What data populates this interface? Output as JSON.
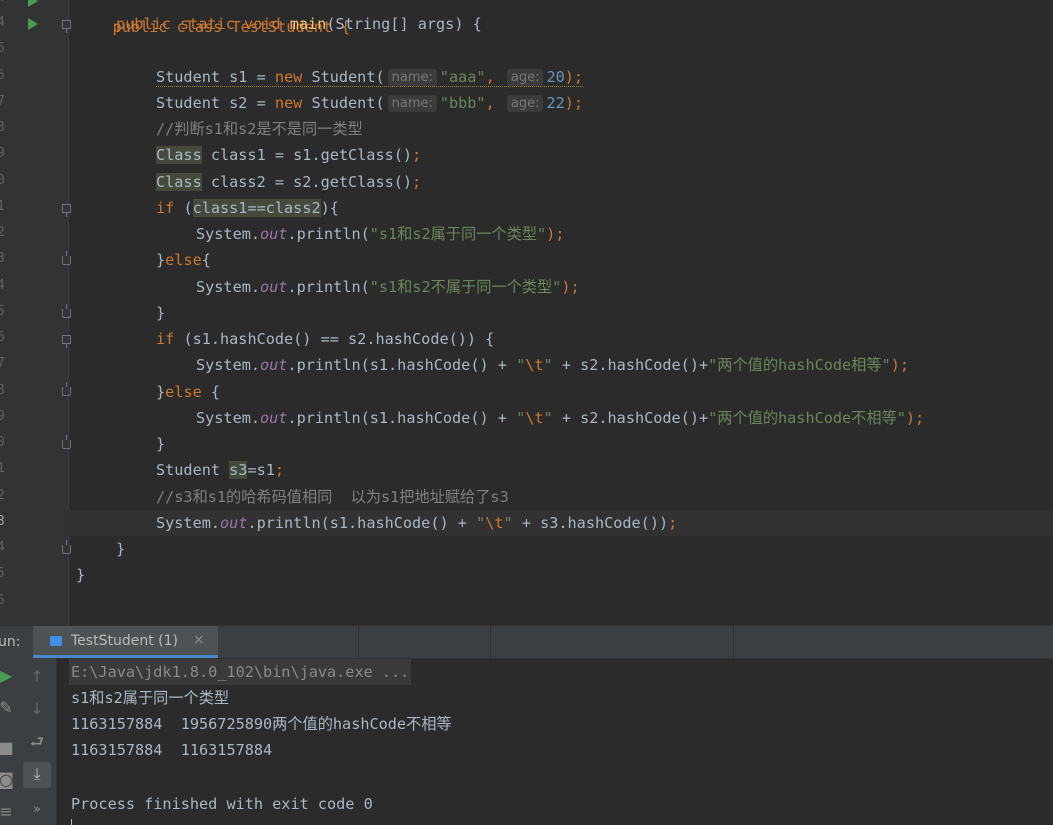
{
  "gutter": {
    "line_numbers": [
      "4",
      "4",
      "5",
      "6",
      "7",
      "8",
      "9",
      "0",
      "1",
      "2",
      "3",
      "4",
      "5",
      "6",
      "7",
      "8",
      "9",
      "0",
      "1",
      "2",
      "3",
      "4",
      "5",
      "6"
    ],
    "run_icon": "run-arrow-icon",
    "fold_icon": "fold-marker-icon"
  },
  "code": {
    "l0": "public class TestStudent {",
    "l1_kw": "public static void ",
    "l1_fn": "main",
    "l1_rest": "(String[] args) {",
    "l3_a": "Student s1 = ",
    "l3_new": "new",
    "l3_b": " Student(",
    "hint_name": "name:",
    "s1_name": "\"aaa\"",
    "comma": ", ",
    "hint_age": "age:",
    "s1_age": "20",
    "close_paren_semi": ");",
    "l4_a": "Student s2 = ",
    "s2_name": "\"bbb\"",
    "s2_age": "22",
    "comment1": "//判断s1和s2是不是同一类型",
    "class_kw": "Class",
    "l6_rest": " class1 = s1.getClass()",
    "l7_rest": " class2 = s2.getClass()",
    "semi": ";",
    "if_kw": "if",
    "else_kw": "else",
    "l8_open": " (",
    "l8_cond": "class1==class2",
    "l8_close": "){",
    "system": "System.",
    "out": "out",
    "println": ".println(",
    "str_same": "\"s1和s2属于同一个类型\"",
    "close_brace": "}",
    "open_brace": "{",
    "str_diff": "\"s1和s2不属于同一个类型\"",
    "l13_a": " (s1.hashCode() == s2.hashCode()) {",
    "hash_a": "s1.hashCode() + ",
    "q": "\"",
    "tab_esc": "\\t",
    "hash_b": " + s2.hashCode()+",
    "str_eq": "\"两个值的hashCode相等\"",
    "else_brace": " {",
    "str_neq": "\"两个值的hashCode不相等\"",
    "l18_a": "Student ",
    "l18_s3": "s3",
    "l18_b": "=s1",
    "comment2": "//s3和s1的哈希码值相同  以为s1把地址赋给了s3",
    "hash_c": " + s3.hashCode())"
  },
  "run_panel": {
    "label": "un:",
    "tab_label": "TestStudent (1)",
    "tab_close": "×",
    "toolbar_icons": [
      "run-icon",
      "wrench-icon",
      "stop-icon",
      "camera-icon",
      "arrow-up-icon",
      "arrow-down-icon",
      "soft-wrap-icon",
      "scroll-to-end-icon",
      "more-icon"
    ],
    "more_label": "»",
    "output": [
      "E:\\Java\\jdk1.8.0_102\\bin\\java.exe ...",
      "s1和s2属于同一个类型",
      "1163157884  1956725890两个值的hashCode不相等",
      "1163157884  1163157884",
      "",
      "Process finished with exit code 0"
    ]
  }
}
